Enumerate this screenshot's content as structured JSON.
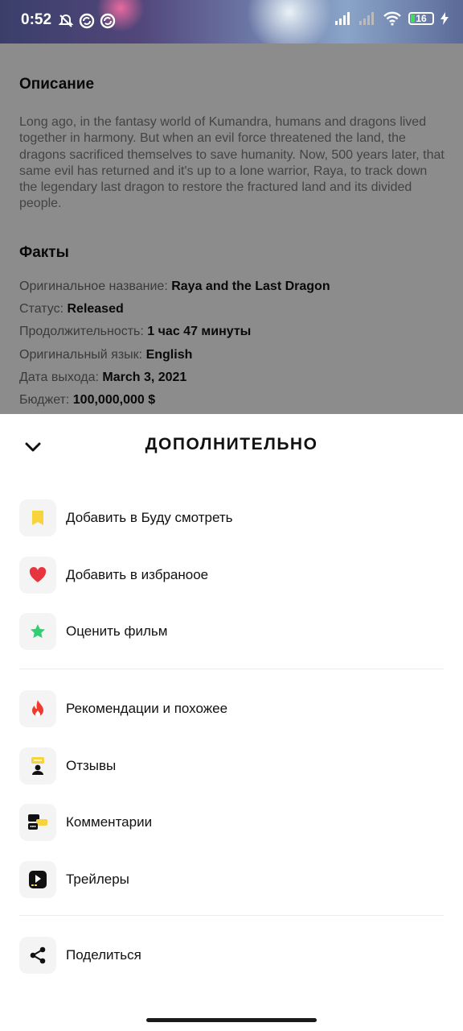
{
  "status_bar": {
    "time": "0:52",
    "notification_icons": [
      "muted-bell-icon",
      "sync-icon",
      "sync-icon"
    ],
    "system_icons": [
      "signal-icon",
      "signal-icon",
      "wifi-icon"
    ],
    "battery_level": "16",
    "charging": true
  },
  "description": {
    "title": "Описание",
    "text": "Long ago, in the fantasy world of Kumandra, humans and dragons lived together in harmony. But when an evil force threatened the land, the dragons sacrificed themselves to save humanity. Now, 500 years later, that same evil has returned and it's up to a lone warrior, Raya, to track down the legendary last dragon to restore the fractured land and its divided people."
  },
  "facts": {
    "title": "Факты",
    "items": [
      {
        "label": "Оригинальное название:",
        "value": "Raya and the Last Dragon"
      },
      {
        "label": "Статус:",
        "value": "Released"
      },
      {
        "label": "Продолжительность:",
        "value": "1 час 47 минуты"
      },
      {
        "label": "Оригинальный язык:",
        "value": "English"
      },
      {
        "label": "Дата выхода:",
        "value": "March 3, 2021"
      },
      {
        "label": "Бюджет:",
        "value": "100,000,000 $"
      }
    ]
  },
  "sheet": {
    "title": "ДОПОЛНИТЕЛЬНО",
    "groups": [
      [
        {
          "label": "Добавить в Буду смотреть",
          "icon": "bookmark-icon",
          "color": "#f7d33c"
        },
        {
          "label": "Добавить в избраноое",
          "icon": "heart-icon",
          "color": "#e8343f"
        },
        {
          "label": "Оценить фильм",
          "icon": "star-icon",
          "color": "#2fcf72"
        }
      ],
      [
        {
          "label": "Рекомендации и похожее",
          "icon": "fire-icon",
          "color": "#ef3b2d"
        },
        {
          "label": "Отзывы",
          "icon": "review-icon",
          "color": "#f7d33c"
        },
        {
          "label": "Комментарии",
          "icon": "comments-icon",
          "color": "#f7d33c"
        },
        {
          "label": "Трейлеры",
          "icon": "trailer-icon",
          "color": "#111111"
        }
      ],
      [
        {
          "label": "Поделиться",
          "icon": "share-icon",
          "color": "#111111"
        }
      ]
    ]
  }
}
